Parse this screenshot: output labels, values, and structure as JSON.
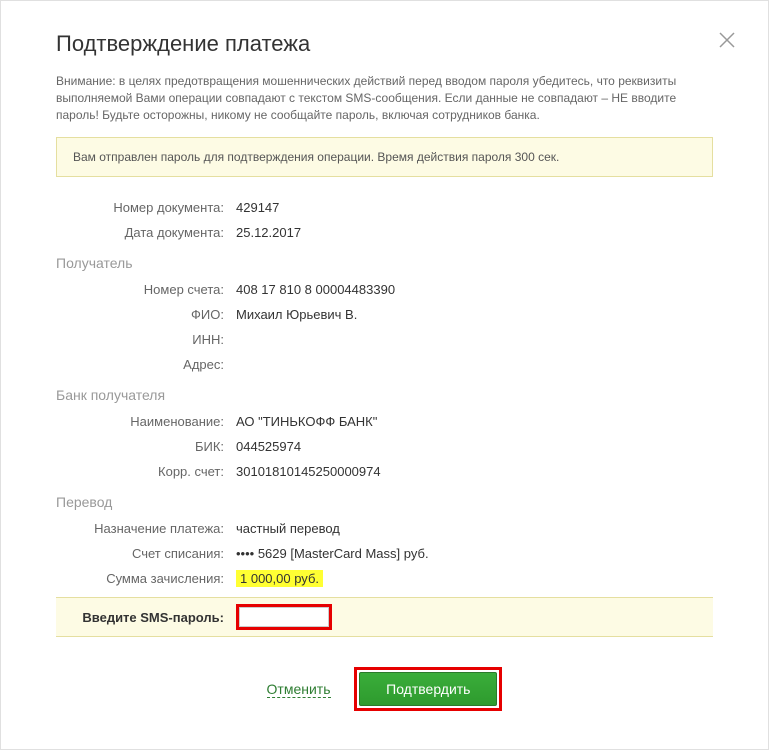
{
  "title": "Подтверждение платежа",
  "warning": "Внимание: в целях предотвращения мошеннических действий перед вводом пароля убедитесь, что реквизиты выполняемой Вами операции совпадают с текстом SMS-сообщения. Если данные не совпадают – НЕ вводите пароль! Будьте осторожны, никому не сообщайте пароль, включая сотрудников банка.",
  "notice": "Вам отправлен пароль для подтверждения операции. Время действия пароля 300 сек.",
  "doc": {
    "number_label": "Номер документа:",
    "number_value": "429147",
    "date_label": "Дата документа:",
    "date_value": "25.12.2017"
  },
  "recipient": {
    "section": "Получатель",
    "account_label": "Номер счета:",
    "account_value": "408 17 810 8 00004483390",
    "fio_label": "ФИО:",
    "fio_value": "Михаил Юрьевич В.",
    "inn_label": "ИНН:",
    "inn_value": "",
    "address_label": "Адрес:",
    "address_value": ""
  },
  "bank": {
    "section": "Банк получателя",
    "name_label": "Наименование:",
    "name_value": "АО \"ТИНЬКОФФ БАНК\"",
    "bik_label": "БИК:",
    "bik_value": "044525974",
    "corr_label": "Корр. счет:",
    "corr_value": "30101810145250000974"
  },
  "transfer": {
    "section": "Перевод",
    "purpose_label": "Назначение платежа:",
    "purpose_value": "частный перевод",
    "debit_label": "Счет списания:",
    "debit_value": "•••• 5629  [MasterCard Mass]  руб.",
    "amount_label": "Сумма зачисления:",
    "amount_value": "1 000,00  руб."
  },
  "sms": {
    "label": "Введите SMS-пароль:",
    "value": ""
  },
  "actions": {
    "cancel": "Отменить",
    "confirm": "Подтвердить"
  }
}
